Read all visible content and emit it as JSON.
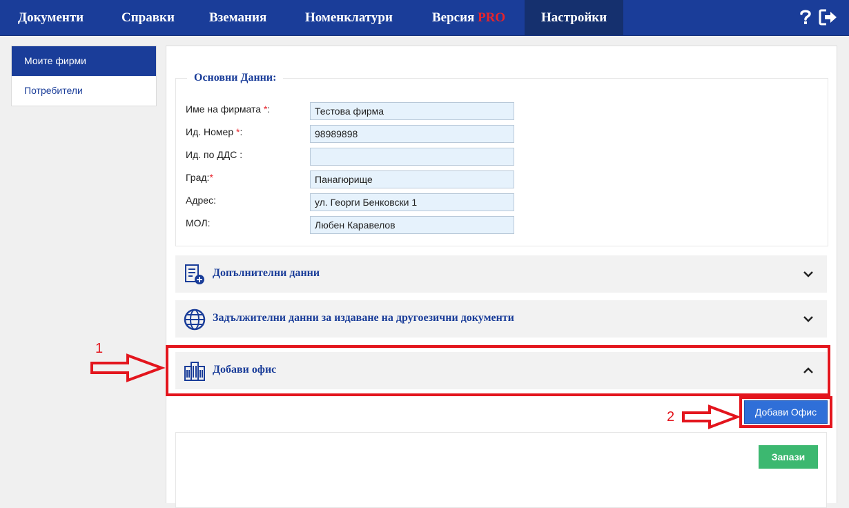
{
  "nav": {
    "items": [
      {
        "label": "Документи"
      },
      {
        "label": "Справки"
      },
      {
        "label": "Вземания"
      },
      {
        "label": "Номенклатури"
      },
      {
        "label": "Версия",
        "badge": "PRO"
      },
      {
        "label": "Настройки"
      }
    ],
    "icons": [
      "help-icon",
      "logout-icon"
    ]
  },
  "sidebar": {
    "items": [
      {
        "label": "Моите фирми",
        "active": true
      },
      {
        "label": "Потребители",
        "active": false
      }
    ]
  },
  "basic": {
    "legend": "Основни Данни:",
    "fields": [
      {
        "label": "Име на фирмата ",
        "required": "*",
        "suffix": ":",
        "value": "Тестова фирма"
      },
      {
        "label": "Ид. Номер ",
        "required": "*",
        "suffix": ":",
        "value": "98989898"
      },
      {
        "label": "Ид. по ДДС :",
        "required": "",
        "suffix": "",
        "value": ""
      },
      {
        "label": "Град:",
        "required": "*",
        "suffix": "",
        "value": "Панагюрище"
      },
      {
        "label": "Адрес:",
        "required": "",
        "suffix": "",
        "value": "ул. Георги Бенковски 1"
      },
      {
        "label": "МОЛ:",
        "required": "",
        "suffix": "",
        "value": "Любен Каравелов"
      }
    ]
  },
  "panels": [
    {
      "title": "Допълнителни данни",
      "icon": "document-add-icon",
      "expanded": false
    },
    {
      "title": "Задължителни данни за издаване на другоезични документи",
      "icon": "globe-icon",
      "expanded": false
    },
    {
      "title": "Добави офис",
      "icon": "building-icon",
      "expanded": true
    }
  ],
  "actions": {
    "add_office": "Добави Офис",
    "save": "Запази"
  },
  "annotations": {
    "marker1": "1",
    "marker2": "2",
    "color": "#e3151d"
  },
  "colors": {
    "nav": "#1a3d99",
    "primary_button": "#2f6fd8",
    "save_button": "#3cb870"
  }
}
